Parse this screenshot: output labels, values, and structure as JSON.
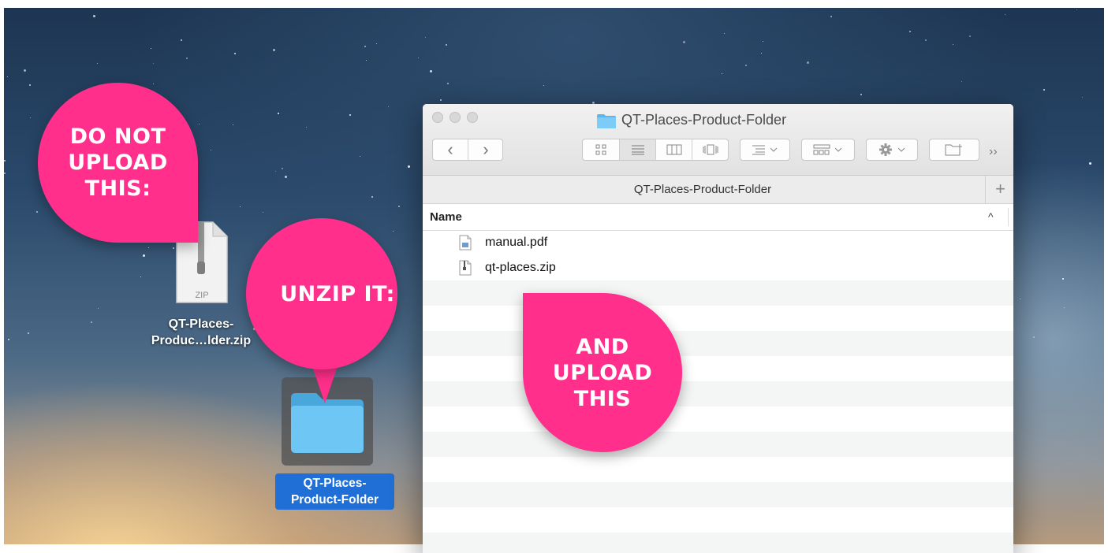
{
  "desktop": {
    "zip_file": {
      "icon_text": "ZIP",
      "label_line1": "QT-Places-",
      "label_line2": "Produc…lder.zip"
    },
    "folder": {
      "label_line1": "QT-Places-",
      "label_line2": "Product-Folder"
    }
  },
  "window": {
    "title": "QT-Places-Product-Folder",
    "toolbar": {
      "back": "‹",
      "forward": "›",
      "overflow": "››"
    },
    "path_bar": "QT-Places-Product-Folder",
    "add_tab": "+",
    "column_header": "Name",
    "sort_indicator": "^",
    "files": [
      {
        "name": "manual.pdf",
        "icon": "pdf-document-icon"
      },
      {
        "name": "qt-places.zip",
        "icon": "zip-archive-icon"
      }
    ]
  },
  "callouts": {
    "do_not_upload": [
      "DO NOT",
      "UPLOAD",
      "THIS:"
    ],
    "unzip": "UNZIP IT:",
    "and_upload": [
      "AND",
      "UPLOAD",
      "THIS"
    ]
  },
  "colors": {
    "callout_pink": "#ff2f8b",
    "selection_blue": "#1f6fd6",
    "folder_blue": "#6ec6f5"
  }
}
